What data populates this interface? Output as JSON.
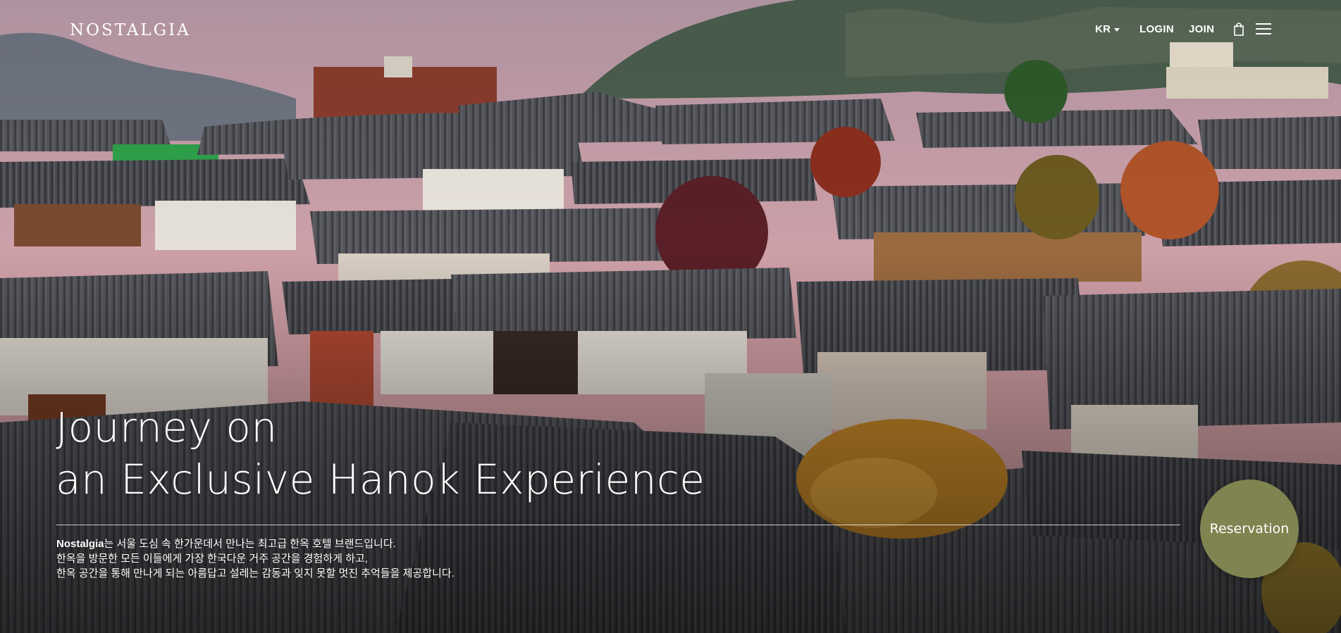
{
  "header": {
    "logo_text": "NOSTALGIA",
    "language": "KR",
    "login_label": "LOGIN",
    "join_label": "JOIN",
    "icons": {
      "bag": "shopping-bag-icon",
      "menu": "hamburger-menu-icon",
      "caret": "caret-down-icon"
    }
  },
  "hero": {
    "headline_line1": "Journey on",
    "headline_line2": "an Exclusive Hanok Experience",
    "brand": "Nostalgia",
    "desc_line1_rest": "는 서울 도심 속 한가운데서 만나는 최고급 한옥 호텔 브랜드입니다.",
    "desc_line2": "한옥을 방문한 모든 이들에게 가장 한국다운 거주 공간을 경험하게 하고,",
    "desc_line3": "한옥 공간을 통해 만나게 되는 아름답고 설레는 감동과 잊지 못할 멋진 추억들을 제공합니다."
  },
  "reservation": {
    "label": "Reservation"
  },
  "colors": {
    "reservation_bg": "#7f8450",
    "text": "#ffffff",
    "sky_top": "#c89aa3",
    "roof": "#4a4a4f"
  }
}
